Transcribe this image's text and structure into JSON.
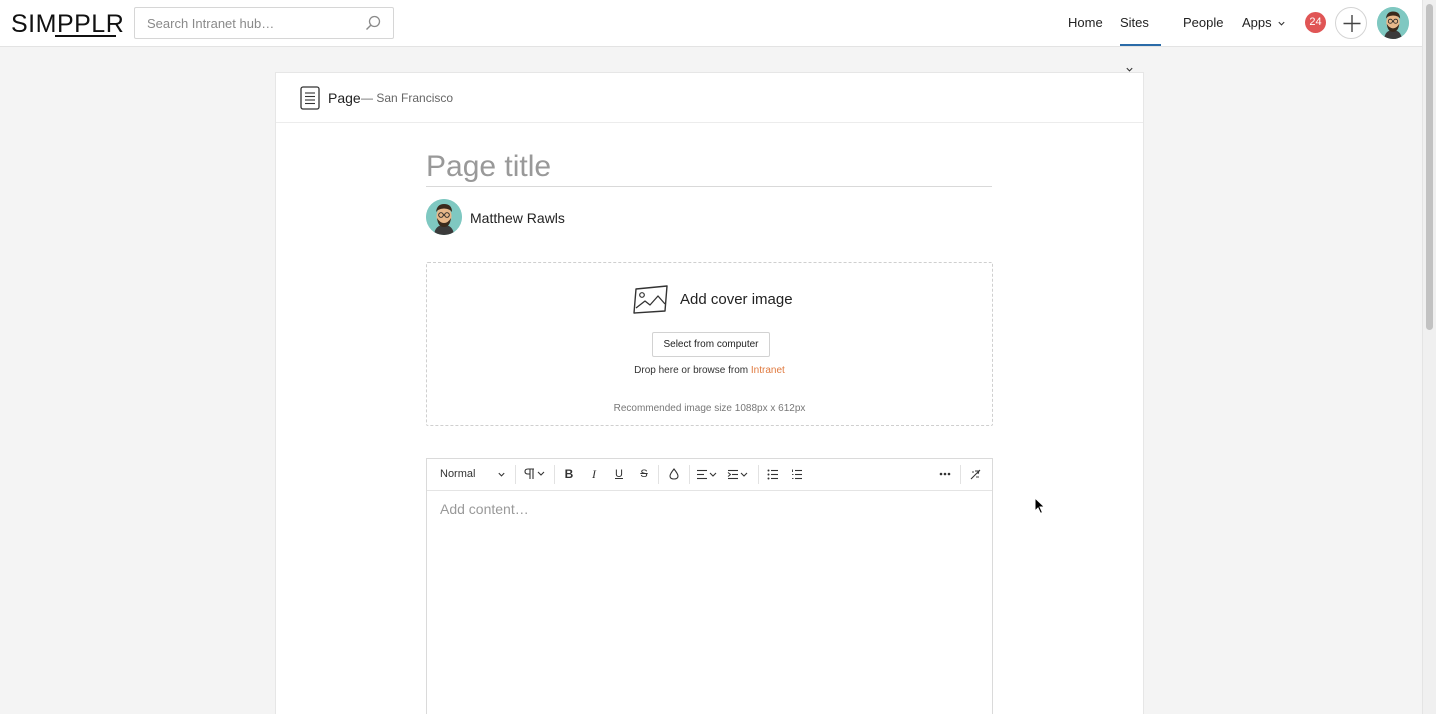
{
  "brand": {
    "logo_text": "SIMPPLR"
  },
  "search": {
    "placeholder": "Search Intranet hub…"
  },
  "nav": {
    "home": "Home",
    "sites": "Sites",
    "people": "People",
    "apps": "Apps",
    "notification_count": "24",
    "active": "Sites",
    "accent_color": "#2a6ba8",
    "badge_color": "#e05555"
  },
  "page_header": {
    "content_type": "Page",
    "site_prefix": "—",
    "site_name": "San Francisco"
  },
  "form": {
    "title_placeholder": "Page title",
    "author_name": "Matthew Rawls"
  },
  "cover_image": {
    "heading": "Add cover image",
    "select_button": "Select from computer",
    "drop_text": "Drop here or browse from",
    "drop_link": "Intranet",
    "recommended": "Recommended image size 1088px x 612px",
    "link_color": "#e07a3f"
  },
  "editor": {
    "paragraph_style": "Normal",
    "content_placeholder": "Add content…",
    "toolbar_icons": [
      "paragraph-format-icon",
      "bold-icon",
      "italic-icon",
      "underline-icon",
      "strikethrough-icon",
      "text-color-icon",
      "align-icon",
      "indent-icon",
      "bullet-list-icon",
      "numbered-list-icon",
      "more-icon",
      "clear-format-icon"
    ]
  }
}
